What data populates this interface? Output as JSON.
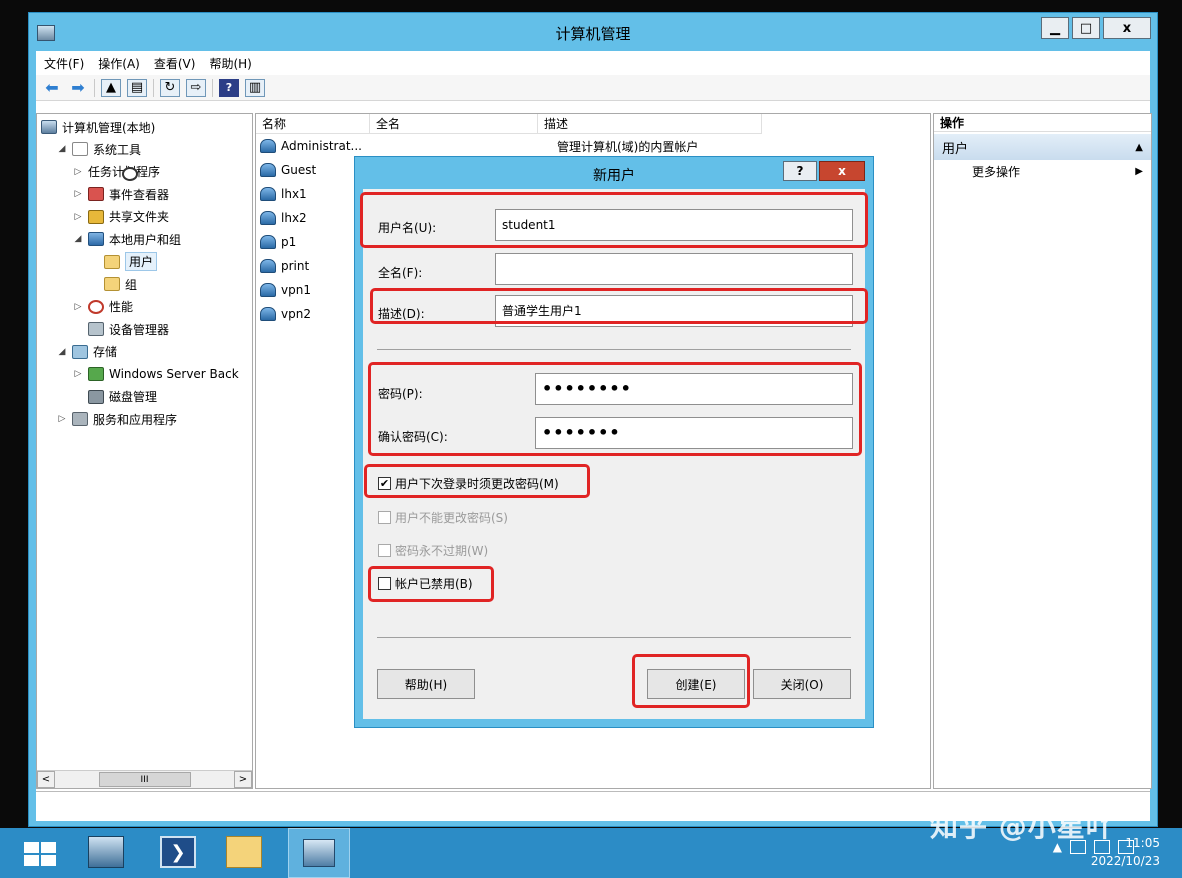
{
  "window": {
    "title": "计算机管理"
  },
  "menu": [
    "文件(F)",
    "操作(A)",
    "查看(V)",
    "帮助(H)"
  ],
  "tree": {
    "root": "计算机管理(本地)",
    "items": [
      {
        "label": "系统工具",
        "level": 1,
        "expander": "◢",
        "icon": "tools-icon"
      },
      {
        "label": "任务计划程序",
        "level": 2,
        "expander": "▷",
        "icon": "clock-icon"
      },
      {
        "label": "事件查看器",
        "level": 2,
        "expander": "▷",
        "icon": "event-icon"
      },
      {
        "label": "共享文件夹",
        "level": 2,
        "expander": "▷",
        "icon": "share-icon"
      },
      {
        "label": "本地用户和组",
        "level": 2,
        "expander": "◢",
        "icon": "users-icon"
      },
      {
        "label": "用户",
        "level": 3,
        "expander": "",
        "icon": "folder-icon",
        "selected": true
      },
      {
        "label": "组",
        "level": 3,
        "expander": "",
        "icon": "folder-icon"
      },
      {
        "label": "性能",
        "level": 2,
        "expander": "▷",
        "icon": "perf-icon"
      },
      {
        "label": "设备管理器",
        "level": 2,
        "expander": "",
        "icon": "device-icon"
      },
      {
        "label": "存储",
        "level": 1,
        "expander": "◢",
        "icon": "storage-icon"
      },
      {
        "label": "Windows Server Back",
        "level": 2,
        "expander": "▷",
        "icon": "backup-icon"
      },
      {
        "label": "磁盘管理",
        "level": 2,
        "expander": "",
        "icon": "disk-icon"
      },
      {
        "label": "服务和应用程序",
        "level": 1,
        "expander": "▷",
        "icon": "services-icon"
      }
    ],
    "scroll_thumb": "III"
  },
  "list": {
    "columns": [
      "名称",
      "全名",
      "描述"
    ],
    "rows": [
      {
        "name": "Administrat...",
        "fullname": "",
        "desc": "管理计算机(域)的内置帐户"
      },
      {
        "name": "Guest",
        "fullname": "",
        "desc": ""
      },
      {
        "name": "lhx1",
        "fullname": "",
        "desc": ""
      },
      {
        "name": "lhx2",
        "fullname": "",
        "desc": ""
      },
      {
        "name": "p1",
        "fullname": "",
        "desc": ""
      },
      {
        "name": "print",
        "fullname": "",
        "desc": ""
      },
      {
        "name": "vpn1",
        "fullname": "",
        "desc": ""
      },
      {
        "name": "vpn2",
        "fullname": "",
        "desc": ""
      }
    ]
  },
  "actions": {
    "header": "操作",
    "section": "用户",
    "more": "更多操作"
  },
  "dialog": {
    "title": "新用户",
    "help_btn": "?",
    "close_btn": "x",
    "username_label": "用户名(U):",
    "username_value": "student1",
    "fullname_label": "全名(F):",
    "fullname_value": "",
    "desc_label": "描述(D):",
    "desc_value": "普通学生用户1",
    "password_label": "密码(P):",
    "password_value": "••••••••",
    "confirm_label": "确认密码(C):",
    "confirm_value": "•••••••",
    "cb_must_change": "用户下次登录时须更改密码(M)",
    "cb_cannot_change": "用户不能更改密码(S)",
    "cb_never_expires": "密码永不过期(W)",
    "cb_disabled": "帐户已禁用(B)",
    "btn_help": "帮助(H)",
    "btn_create": "创建(E)",
    "btn_close": "关闭(O)"
  },
  "taskbar": {
    "time": "11:05",
    "date": "2022/10/23"
  },
  "watermark": "知乎 @小星吖",
  "colors": {
    "accent": "#63bfe8",
    "highlight": "#e02424",
    "taskbar": "#2c8cc6"
  }
}
